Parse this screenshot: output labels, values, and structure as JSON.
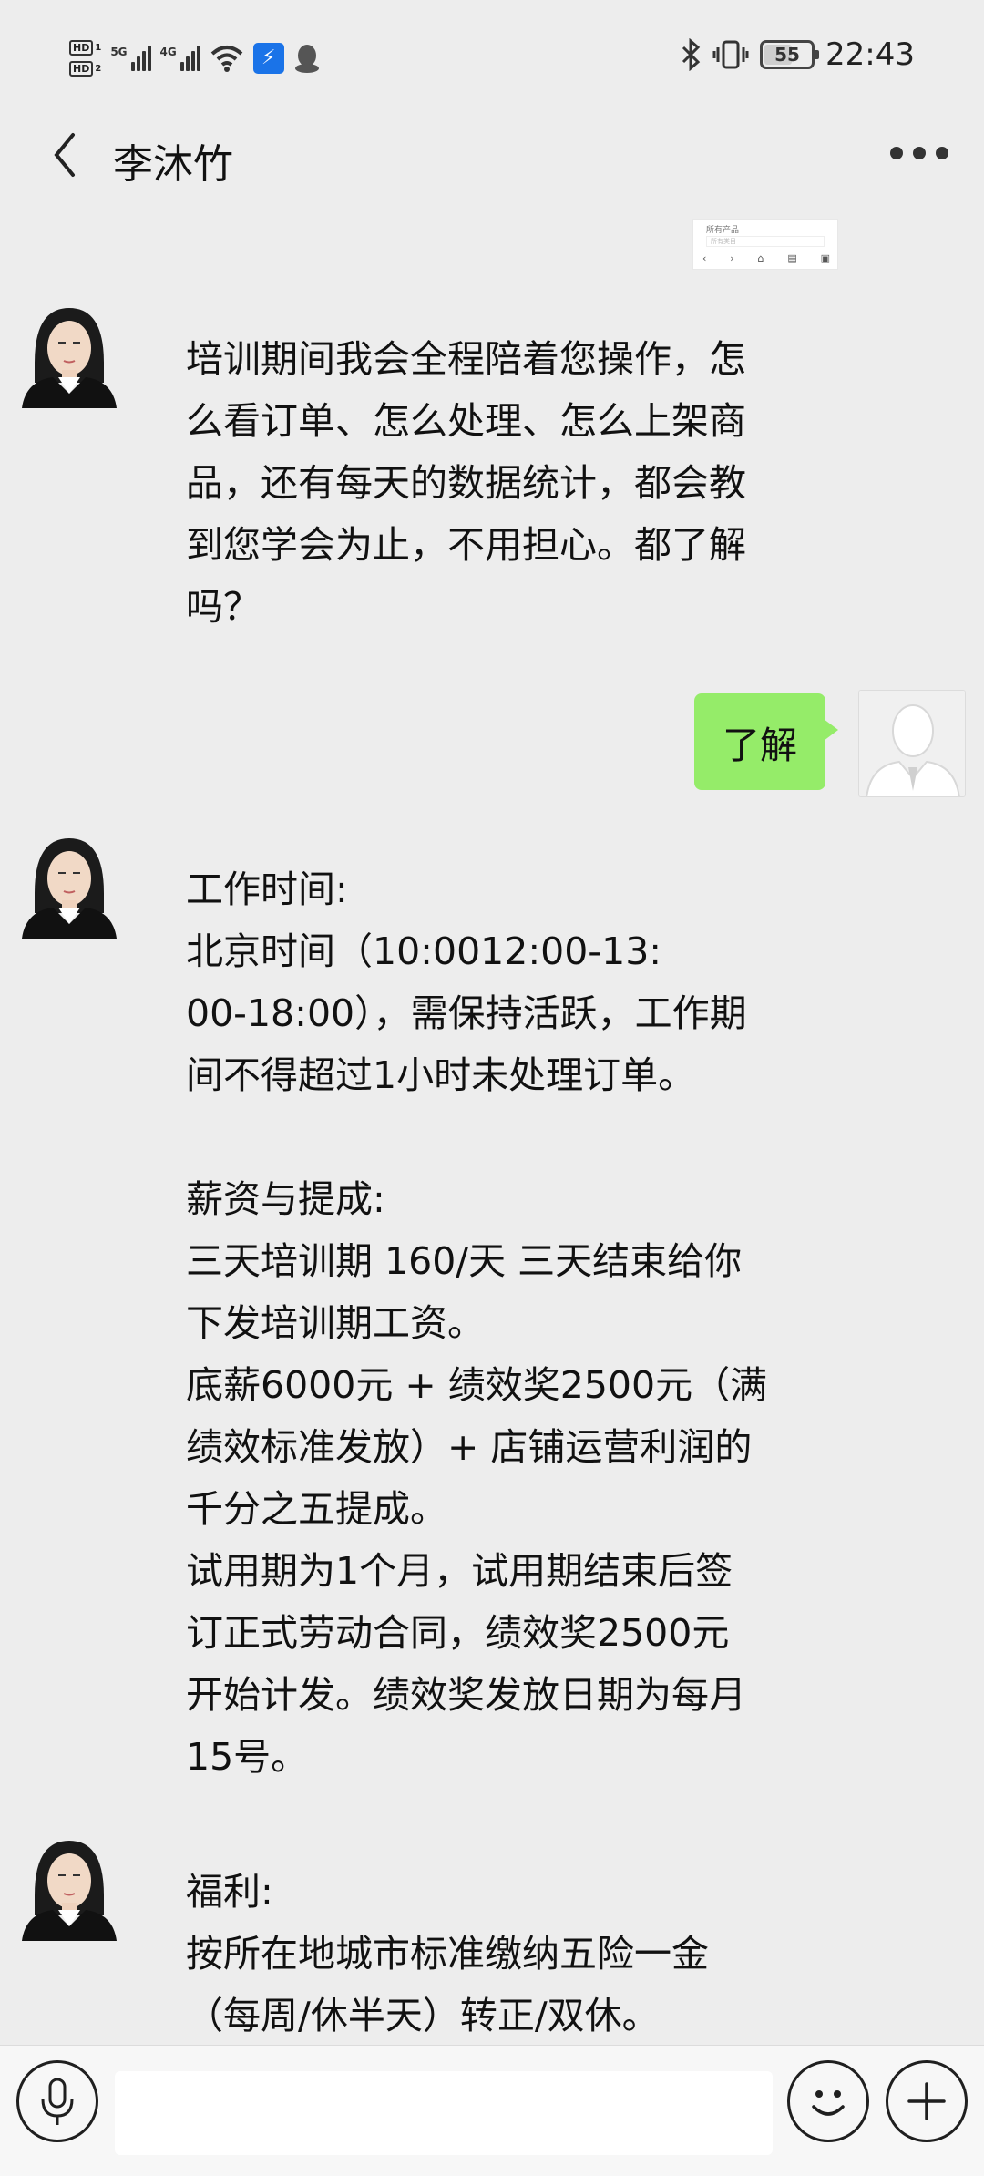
{
  "status_bar": {
    "sim1": "HD",
    "sim1_index": "1",
    "sim2": "HD",
    "sim2_index": "2",
    "network1": "5G",
    "network2": "4G",
    "battery": "55",
    "time": "22:43"
  },
  "header": {
    "contact_name": "李沐竹"
  },
  "thumbnail": {
    "title": "所有产品",
    "search_placeholder": "所有类目",
    "icons": [
      "‹",
      "›",
      "⌂",
      "▤",
      "▣"
    ]
  },
  "messages": [
    {
      "from": "other",
      "text": "培训期间我会全程陪着您操作，怎\n么看订单、怎么处理、怎么上架商\n品，还有每天的数据统计，都会教\n到您学会为止，不用担心。都了解\n吗？"
    },
    {
      "from": "self",
      "text": "了解"
    },
    {
      "from": "other",
      "text": "工作时间:\n北京时间（10:0012:00-13:\n00-18:00），需保持活跃，工作期\n间不得超过1小时未处理订单。\n\n薪资与提成:\n三天培训期 160/天 三天结束给你\n下发培训期工资。\n底薪6000元 + 绩效奖2500元（满\n绩效标准发放）+ 店铺运营利润的\n千分之五提成。\n试用期为1个月，试用期结束后签\n订正式劳动合同，绩效奖2500元\n开始计发。绩效奖发放日期为每月\n15号。"
    },
    {
      "from": "other",
      "text": "福利:\n按所在地城市标准缴纳五险一金\n（每周/休半天）转正/双休。"
    }
  ],
  "input": {
    "value": "",
    "placeholder": ""
  }
}
